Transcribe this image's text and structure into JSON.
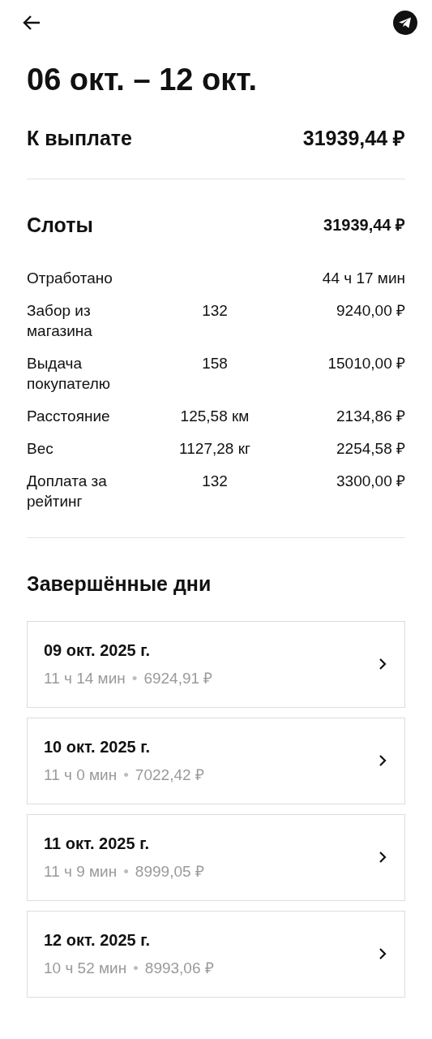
{
  "title": "06 окт. – 12 окт.",
  "payout": {
    "label": "К выплате",
    "amount": "31939,44 ₽"
  },
  "slots": {
    "title": "Слоты",
    "amount": "31939,44 ₽",
    "rows": [
      {
        "label": "Отработано",
        "amount": "44 ч 17 мин"
      },
      {
        "label": "Забор из магазина",
        "count": "132",
        "amount": "9240,00 ₽"
      },
      {
        "label": "Выдача покупателю",
        "count": "158",
        "amount": "15010,00 ₽"
      },
      {
        "label": "Расстояние",
        "count": "125,58 км",
        "amount": "2134,86 ₽"
      },
      {
        "label": "Вес",
        "count": "1127,28 кг",
        "amount": "2254,58 ₽"
      },
      {
        "label": "Доплата за рейтинг",
        "count": "132",
        "amount": "3300,00 ₽"
      }
    ]
  },
  "completed": {
    "title": "Завершённые дни",
    "days": [
      {
        "date": "09 окт. 2025 г.",
        "duration": "11 ч 14 мин",
        "separator": "•",
        "amount": "6924,91 ₽"
      },
      {
        "date": "10 окт. 2025 г.",
        "duration": "11 ч 0 мин",
        "separator": "•",
        "amount": "7022,42 ₽"
      },
      {
        "date": "11 окт. 2025 г.",
        "duration": "11 ч 9 мин",
        "separator": "•",
        "amount": "8999,05 ₽"
      },
      {
        "date": "12 окт. 2025 г.",
        "duration": "10 ч 52 мин",
        "separator": "•",
        "amount": "8993,06 ₽"
      }
    ]
  }
}
